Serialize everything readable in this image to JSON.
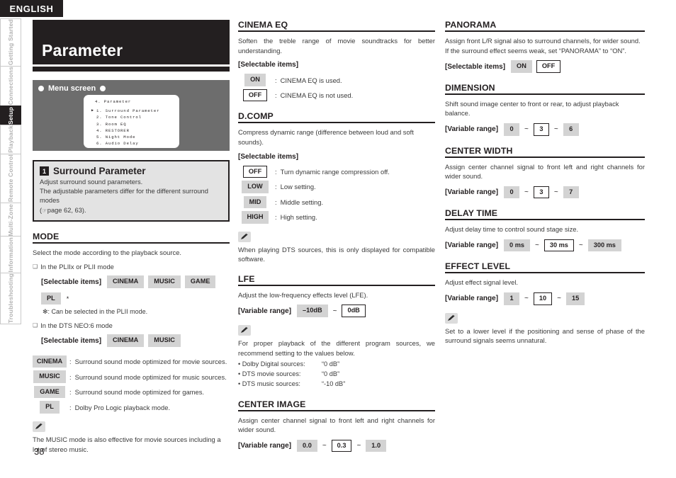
{
  "language_tab": "ENGLISH",
  "page_number": "38",
  "sidebar": {
    "items": [
      {
        "label": "Getting Started",
        "active": false
      },
      {
        "label": "Connections",
        "active": false
      },
      {
        "label": "Setup",
        "active": true
      },
      {
        "label": "Playback",
        "active": false
      },
      {
        "label": "Remote Control",
        "active": false
      },
      {
        "label": "Multi-Zone",
        "active": false
      },
      {
        "label": "Information",
        "active": false
      },
      {
        "label": "Troubleshooting",
        "active": false
      }
    ]
  },
  "banner": {
    "title": "Parameter"
  },
  "menu_screen": {
    "title": "Menu screen",
    "osd_heading": "4. Parameter",
    "osd_items": [
      "1. Surround Parameter",
      "2. Tone Control",
      "3. Room EQ",
      "4. RESTORER",
      "5. Night Mode",
      "6. Audio Delay"
    ],
    "selected_index": 0
  },
  "callout": {
    "number": "1",
    "title": "Surround Parameter",
    "line1": "Adjust surround sound parameters.",
    "line2": "The adjustable parameters differ for the different surround modes",
    "line3": "page 62, 63)."
  },
  "sections": {
    "mode": {
      "heading": "MODE",
      "body": "Select the mode according to the playback source.",
      "group1_label": "In the PLIIx or PLII mode",
      "group1_items_label": "[Selectable items]",
      "group1_items": [
        "CINEMA",
        "MUSIC",
        "GAME",
        "PL"
      ],
      "group1_star": "*",
      "group1_footnote": "✻:  Can be selected in the PLII mode.",
      "group2_label": "In the DTS NEO:6 mode",
      "group2_items_label": "[Selectable items]",
      "group2_items": [
        "CINEMA",
        "MUSIC"
      ],
      "definitions": [
        {
          "chip": "CINEMA",
          "text": "Surround sound mode optimized for movie sources."
        },
        {
          "chip": "MUSIC",
          "text": "Surround sound mode optimized for music sources."
        },
        {
          "chip": "GAME",
          "text": "Surround sound mode optimized for games."
        },
        {
          "chip": "PL",
          "text": "Dolby Pro Logic playback mode."
        }
      ],
      "note": "The MUSIC mode is also effective for movie sources including a lot of stereo music."
    },
    "cinema_eq": {
      "heading": "CINEMA EQ",
      "body": "Soften the treble range of movie soundtracks for better understanding.",
      "items_label": "[Selectable items]",
      "definitions": [
        {
          "chip": "ON",
          "default": false,
          "text": "CINEMA EQ is used."
        },
        {
          "chip": "OFF",
          "default": true,
          "text": "CINEMA EQ is not used."
        }
      ]
    },
    "dcomp": {
      "heading": "D.COMP",
      "body": "Compress dynamic range (difference between loud and soft sounds).",
      "items_label": "[Selectable items]",
      "definitions": [
        {
          "chip": "OFF",
          "default": true,
          "text": "Turn dynamic range compression off."
        },
        {
          "chip": "LOW",
          "default": false,
          "text": "Low setting."
        },
        {
          "chip": "MID",
          "default": false,
          "text": "Middle setting."
        },
        {
          "chip": "HIGH",
          "default": false,
          "text": "High setting."
        }
      ],
      "note": "When playing DTS sources, this is only displayed for compatible software."
    },
    "lfe": {
      "heading": "LFE",
      "body": "Adjust the low-frequency effects level (LFE).",
      "range_label": "[Variable range]",
      "range_min": "–10dB",
      "range_max": "0dB",
      "range_max_default": true,
      "note_intro": "For proper playback of the different program sources, we recommend setting to the values below.",
      "note_bullets": [
        {
          "name": "• Dolby Digital sources:",
          "value": "“0 dB”"
        },
        {
          "name": "• DTS movie sources:",
          "value": "“0 dB”"
        },
        {
          "name": "• DTS music sources:",
          "value": "“-10 dB”"
        }
      ]
    },
    "center_image": {
      "heading": "CENTER IMAGE",
      "body": "Assign center channel signal to front left and right channels for wider sound.",
      "range_label": "[Variable range]",
      "range_min": "0.0",
      "range_default": "0.3",
      "range_max": "1.0"
    },
    "panorama": {
      "heading": "PANORAMA",
      "body": "Assign front L/R signal also to surround channels, for wider sound. If the surround effect seems weak, set “PANORAMA” to “ON”.",
      "items_label": "[Selectable items]",
      "items": [
        {
          "chip": "ON",
          "default": false
        },
        {
          "chip": "OFF",
          "default": true
        }
      ]
    },
    "dimension": {
      "heading": "DIMENSION",
      "body": "Shift sound image center to front or rear, to adjust playback balance.",
      "range_label": "[Variable range]",
      "range_min": "0",
      "range_default": "3",
      "range_max": "6"
    },
    "center_width": {
      "heading": "CENTER WIDTH",
      "body": "Assign center channel signal to front left and right channels for wider sound.",
      "range_label": "[Variable range]",
      "range_min": "0",
      "range_default": "3",
      "range_max": "7"
    },
    "delay_time": {
      "heading": "DELAY TIME",
      "body": "Adjust delay time to control sound stage size.",
      "range_label": "[Variable range]",
      "range_min": "0 ms",
      "range_default": "30 ms",
      "range_max": "300 ms"
    },
    "effect_level": {
      "heading": "EFFECT LEVEL",
      "body": "Adjust effect signal level.",
      "range_label": "[Variable range]",
      "range_min": "1",
      "range_default": "10",
      "range_max": "15",
      "note": "Set to a lower level if the positioning and sense of phase of the surround signals seems unnatural."
    }
  },
  "tilde": "~",
  "colon": ":"
}
